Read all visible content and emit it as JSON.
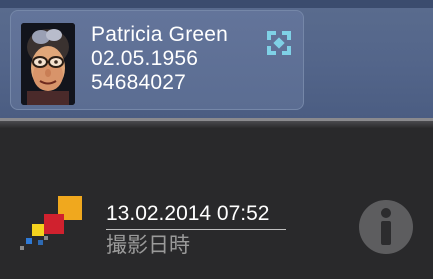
{
  "patient": {
    "name": "Patricia  Green",
    "birth_date": "02.05.1956",
    "patient_id": "54684027",
    "avatar_icon": "patient-avatar-icon",
    "unlink_icon": "unlink-icon",
    "unlink_color": "#7fd1e6"
  },
  "image": {
    "datetime": "13.02.2014 07:52",
    "datetime_label": "撮影日時",
    "app_logo_icon": "app-logo-icon",
    "info_icon": "info-icon"
  },
  "colors": {
    "header_blue": "#5a6c8e",
    "background_dark": "#29292b",
    "logo_orange": "#f0a81e",
    "logo_red": "#d0212e",
    "logo_yellow": "#f4d21e",
    "logo_blue": "#2f7ad6"
  }
}
